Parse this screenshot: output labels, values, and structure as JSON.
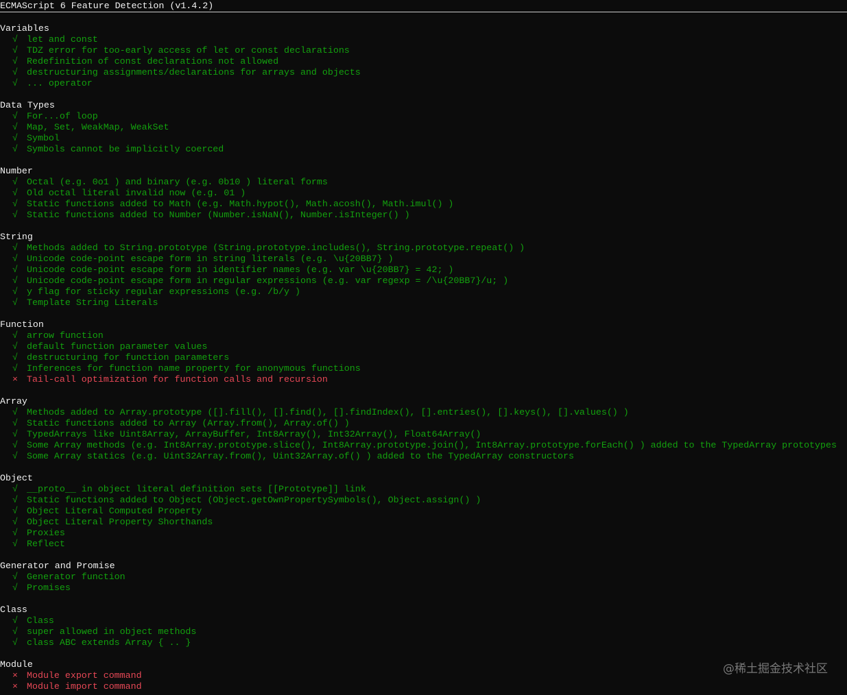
{
  "window": {
    "title": "ECMAScript 6 Feature Detection (v1.4.2)"
  },
  "symbols": {
    "pass": "√",
    "fail": "×"
  },
  "colors": {
    "background": "#0c0c0c",
    "pass": "#13a10e",
    "fail": "#e74856",
    "heading": "#f2f2f2"
  },
  "sections": [
    {
      "title": "Variables",
      "items": [
        {
          "status": "pass",
          "text": "let and const"
        },
        {
          "status": "pass",
          "text": "TDZ error for too-early access of let or const declarations"
        },
        {
          "status": "pass",
          "text": "Redefinition of const declarations not allowed"
        },
        {
          "status": "pass",
          "text": "destructuring assignments/declarations for arrays and objects"
        },
        {
          "status": "pass",
          "text": "... operator"
        }
      ]
    },
    {
      "title": "Data Types",
      "items": [
        {
          "status": "pass",
          "text": "For...of loop"
        },
        {
          "status": "pass",
          "text": "Map, Set, WeakMap, WeakSet"
        },
        {
          "status": "pass",
          "text": "Symbol"
        },
        {
          "status": "pass",
          "text": "Symbols cannot be implicitly coerced"
        }
      ]
    },
    {
      "title": "Number",
      "items": [
        {
          "status": "pass",
          "text": "Octal (e.g. 0o1 ) and binary (e.g. 0b10 ) literal forms"
        },
        {
          "status": "pass",
          "text": "Old octal literal invalid now (e.g. 01 )"
        },
        {
          "status": "pass",
          "text": "Static functions added to Math (e.g. Math.hypot(), Math.acosh(), Math.imul() )"
        },
        {
          "status": "pass",
          "text": "Static functions added to Number (Number.isNaN(), Number.isInteger() )"
        }
      ]
    },
    {
      "title": "String",
      "items": [
        {
          "status": "pass",
          "text": "Methods added to String.prototype (String.prototype.includes(), String.prototype.repeat() )"
        },
        {
          "status": "pass",
          "text": "Unicode code-point escape form in string literals (e.g. \\u{20BB7} )"
        },
        {
          "status": "pass",
          "text": "Unicode code-point escape form in identifier names (e.g. var \\u{20BB7} = 42; )"
        },
        {
          "status": "pass",
          "text": "Unicode code-point escape form in regular expressions (e.g. var regexp = /\\u{20BB7}/u; )"
        },
        {
          "status": "pass",
          "text": "y flag for sticky regular expressions (e.g. /b/y )"
        },
        {
          "status": "pass",
          "text": "Template String Literals"
        }
      ]
    },
    {
      "title": "Function",
      "items": [
        {
          "status": "pass",
          "text": "arrow function"
        },
        {
          "status": "pass",
          "text": "default function parameter values"
        },
        {
          "status": "pass",
          "text": "destructuring for function parameters"
        },
        {
          "status": "pass",
          "text": "Inferences for function name property for anonymous functions"
        },
        {
          "status": "fail",
          "text": "Tail-call optimization for function calls and recursion"
        }
      ]
    },
    {
      "title": "Array",
      "items": [
        {
          "status": "pass",
          "text": "Methods added to Array.prototype ([].fill(), [].find(), [].findIndex(), [].entries(), [].keys(), [].values() )"
        },
        {
          "status": "pass",
          "text": "Static functions added to Array (Array.from(), Array.of() )"
        },
        {
          "status": "pass",
          "text": "TypedArrays like Uint8Array, ArrayBuffer, Int8Array(), Int32Array(), Float64Array()"
        },
        {
          "status": "pass",
          "text": "Some Array methods (e.g. Int8Array.prototype.slice(), Int8Array.prototype.join(), Int8Array.prototype.forEach() ) added to the TypedArray prototypes"
        },
        {
          "status": "pass",
          "text": "Some Array statics (e.g. Uint32Array.from(), Uint32Array.of() ) added to the TypedArray constructors"
        }
      ]
    },
    {
      "title": "Object",
      "items": [
        {
          "status": "pass",
          "text": "__proto__ in object literal definition sets [[Prototype]] link"
        },
        {
          "status": "pass",
          "text": "Static functions added to Object (Object.getOwnPropertySymbols(), Object.assign() )"
        },
        {
          "status": "pass",
          "text": "Object Literal Computed Property"
        },
        {
          "status": "pass",
          "text": "Object Literal Property Shorthands"
        },
        {
          "status": "pass",
          "text": "Proxies"
        },
        {
          "status": "pass",
          "text": "Reflect"
        }
      ]
    },
    {
      "title": "Generator and Promise",
      "items": [
        {
          "status": "pass",
          "text": "Generator function"
        },
        {
          "status": "pass",
          "text": "Promises"
        }
      ]
    },
    {
      "title": "Class",
      "items": [
        {
          "status": "pass",
          "text": "Class"
        },
        {
          "status": "pass",
          "text": "super allowed in object methods"
        },
        {
          "status": "pass",
          "text": "class ABC extends Array { .. }"
        }
      ]
    },
    {
      "title": "Module",
      "items": [
        {
          "status": "fail",
          "text": "Module export command"
        },
        {
          "status": "fail",
          "text": "Module import command"
        }
      ]
    }
  ],
  "watermark": "@稀土掘金技术社区"
}
